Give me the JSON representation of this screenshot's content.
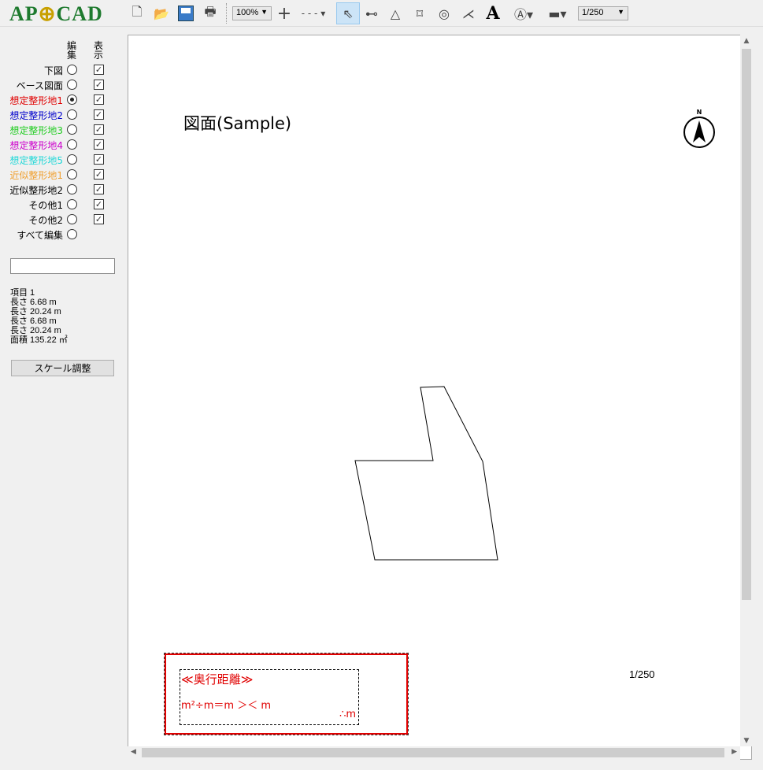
{
  "app": {
    "logo": "APOCAD"
  },
  "toolbar": {
    "zoom": "100%",
    "scale": "1/250",
    "icons": [
      "new-file-icon",
      "open-folder-icon",
      "save-icon",
      "print-icon",
      "crosshair-icon",
      "dash-line-icon",
      "select-arrow-icon",
      "segment-icon",
      "triangle-icon",
      "rectangle-icon",
      "circle-icon",
      "branch-icon",
      "text-icon",
      "north-arrow-icon",
      "road-shape-icon"
    ]
  },
  "sidebar": {
    "header_edit": "編\n集",
    "header_show": "表\n示",
    "layers": [
      {
        "label": "下図",
        "color": "#000000",
        "edit": false,
        "show": true
      },
      {
        "label": "ベース図面",
        "color": "#000000",
        "edit": false,
        "show": true
      },
      {
        "label": "想定整形地1",
        "color": "#e00000",
        "edit": true,
        "show": true
      },
      {
        "label": "想定整形地2",
        "color": "#0000cc",
        "edit": false,
        "show": true
      },
      {
        "label": "想定整形地3",
        "color": "#22cc22",
        "edit": false,
        "show": true
      },
      {
        "label": "想定整形地4",
        "color": "#cc00cc",
        "edit": false,
        "show": true
      },
      {
        "label": "想定整形地5",
        "color": "#22d8d8",
        "edit": false,
        "show": true
      },
      {
        "label": "近似整形地1",
        "color": "#f0a030",
        "edit": false,
        "show": true
      },
      {
        "label": "近似整形地2",
        "color": "#000000",
        "edit": false,
        "show": true
      },
      {
        "label": "その他1",
        "color": "#000000",
        "edit": false,
        "show": true
      },
      {
        "label": "その他2",
        "color": "#000000",
        "edit": false,
        "show": true
      },
      {
        "label": "すべて編集",
        "color": "#000000",
        "edit": false,
        "show": null
      }
    ],
    "input_value": "",
    "info": [
      "項目 1",
      " 長さ 6.68 m",
      " 長さ 20.24 m",
      " 長さ 6.68 m",
      " 長さ 20.24 m",
      " 面積 135.22 ㎡"
    ],
    "scale_button": "スケール調整"
  },
  "canvas": {
    "title": "図面(Sample)",
    "north": "N",
    "scale_label": "1/250",
    "box_title": "≪奥行距離≫",
    "box_formula": "m²÷m＝m ＞＜ m",
    "box_result": "∴m"
  }
}
